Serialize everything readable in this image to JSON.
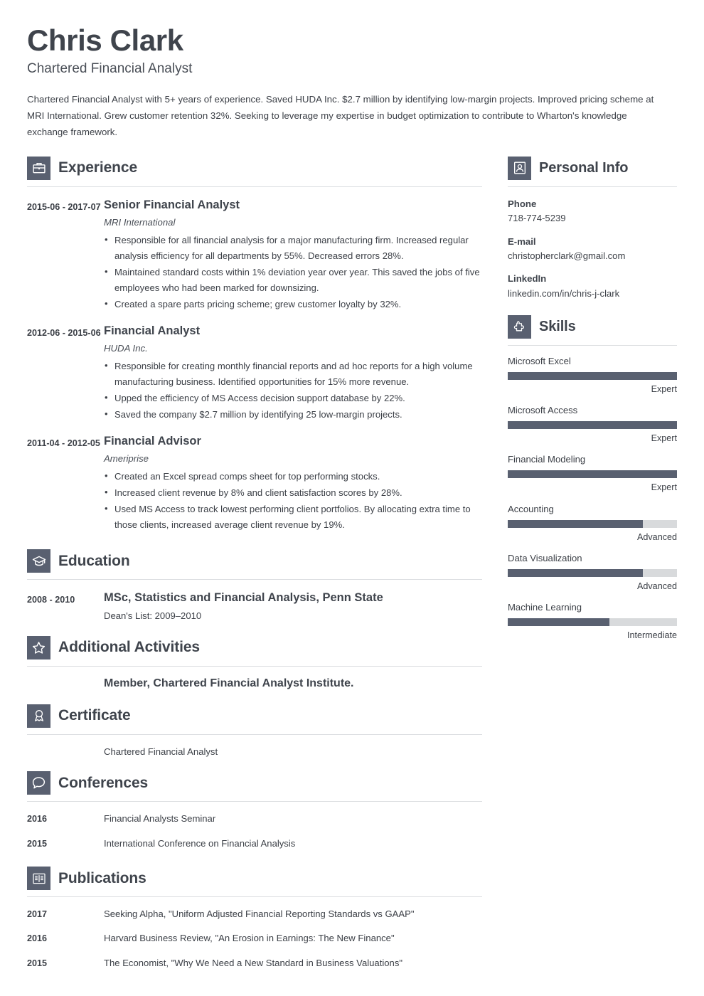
{
  "header": {
    "name": "Chris Clark",
    "job_title": "Chartered Financial Analyst",
    "summary": "Chartered Financial Analyst with 5+ years of experience. Saved HUDA Inc. $2.7 million by identifying low-margin projects. Improved pricing scheme at MRI International. Grew customer retention 32%. Seeking to leverage my expertise in budget optimization to contribute to Wharton's knowledge exchange framework."
  },
  "colors": {
    "icon_background": "#596070",
    "heading_text": "#3f444c",
    "body_text": "#3b3f46",
    "rule": "#dcdee1",
    "skill_track": "#d8dadc",
    "skill_fill": "#596070"
  },
  "sections": {
    "experience": {
      "title": "Experience",
      "icon": "briefcase-icon",
      "entries": [
        {
          "date": "2015-06 - 2017-07",
          "title": "Senior Financial Analyst",
          "company": "MRI International",
          "bullets": [
            "Responsible for all financial analysis for a major manufacturing firm. Increased regular analysis efficiency for all departments by 55%. Decreased errors 28%.",
            "Maintained standard costs within 1% deviation year over year. This saved the jobs of five employees who had been marked for downsizing.",
            "Created a spare parts pricing scheme; grew customer loyalty by 32%."
          ]
        },
        {
          "date": "2012-06 - 2015-06",
          "title": "Financial Analyst",
          "company": "HUDA Inc.",
          "bullets": [
            "Responsible for creating monthly financial reports and ad hoc reports for a high volume manufacturing business. Identified opportunities for 15% more revenue.",
            "Upped the efficiency of MS Access decision support database by 22%.",
            "Saved the company $2.7 million by identifying 25 low-margin projects."
          ]
        },
        {
          "date": "2011-04 - 2012-05",
          "title": "Financial Advisor",
          "company": "Ameriprise",
          "bullets": [
            "Created an Excel spread comps sheet for top performing stocks.",
            "Increased client revenue by 8% and client satisfaction scores by 28%.",
            "Used MS Access to track lowest performing client portfolios. By allocating extra time to those clients, increased average client revenue by 19%."
          ]
        }
      ]
    },
    "education": {
      "title": "Education",
      "icon": "graduation-cap-icon",
      "entries": [
        {
          "date": "2008 - 2010",
          "title": "MSc, Statistics and Financial Analysis, Penn State",
          "note": "Dean's List: 2009–2010"
        }
      ]
    },
    "additional_activities": {
      "title": "Additional Activities",
      "icon": "star-icon",
      "entries": [
        {
          "date": "",
          "text": "Member, Chartered Financial Analyst Institute."
        }
      ]
    },
    "certificate": {
      "title": "Certificate",
      "icon": "award-ribbon-icon",
      "entries": [
        {
          "date": "",
          "text": "Chartered Financial Analyst"
        }
      ]
    },
    "conferences": {
      "title": "Conferences",
      "icon": "speech-bubble-icon",
      "entries": [
        {
          "date": "2016",
          "text": "Financial Analysts Seminar"
        },
        {
          "date": "2015",
          "text": "International Conference on Financial Analysis"
        }
      ]
    },
    "publications": {
      "title": "Publications",
      "icon": "open-book-icon",
      "entries": [
        {
          "date": "2017",
          "text": "Seeking Alpha, \"Uniform Adjusted Financial Reporting Standards vs GAAP\""
        },
        {
          "date": "2016",
          "text": "Harvard Business Review, \"An Erosion in Earnings: The New Finance\""
        },
        {
          "date": "2015",
          "text": "The Economist, \"Why We Need a New Standard in Business Valuations\""
        }
      ]
    },
    "personal_info": {
      "title": "Personal Info",
      "icon": "person-badge-icon",
      "fields": [
        {
          "label": "Phone",
          "value": "718-774-5239"
        },
        {
          "label": "E-mail",
          "value": "christopherclark@gmail.com"
        },
        {
          "label": "LinkedIn",
          "value": "linkedin.com/in/chris-j-clark"
        }
      ]
    },
    "skills": {
      "title": "Skills",
      "icon": "puzzle-piece-icon",
      "items": [
        {
          "name": "Microsoft Excel",
          "level": "Expert",
          "percent": 100
        },
        {
          "name": "Microsoft Access",
          "level": "Expert",
          "percent": 100
        },
        {
          "name": "Financial Modeling",
          "level": "Expert",
          "percent": 100
        },
        {
          "name": "Accounting",
          "level": "Advanced",
          "percent": 80
        },
        {
          "name": "Data Visualization",
          "level": "Advanced",
          "percent": 80
        },
        {
          "name": "Machine Learning",
          "level": "Intermediate",
          "percent": 60
        }
      ]
    }
  }
}
